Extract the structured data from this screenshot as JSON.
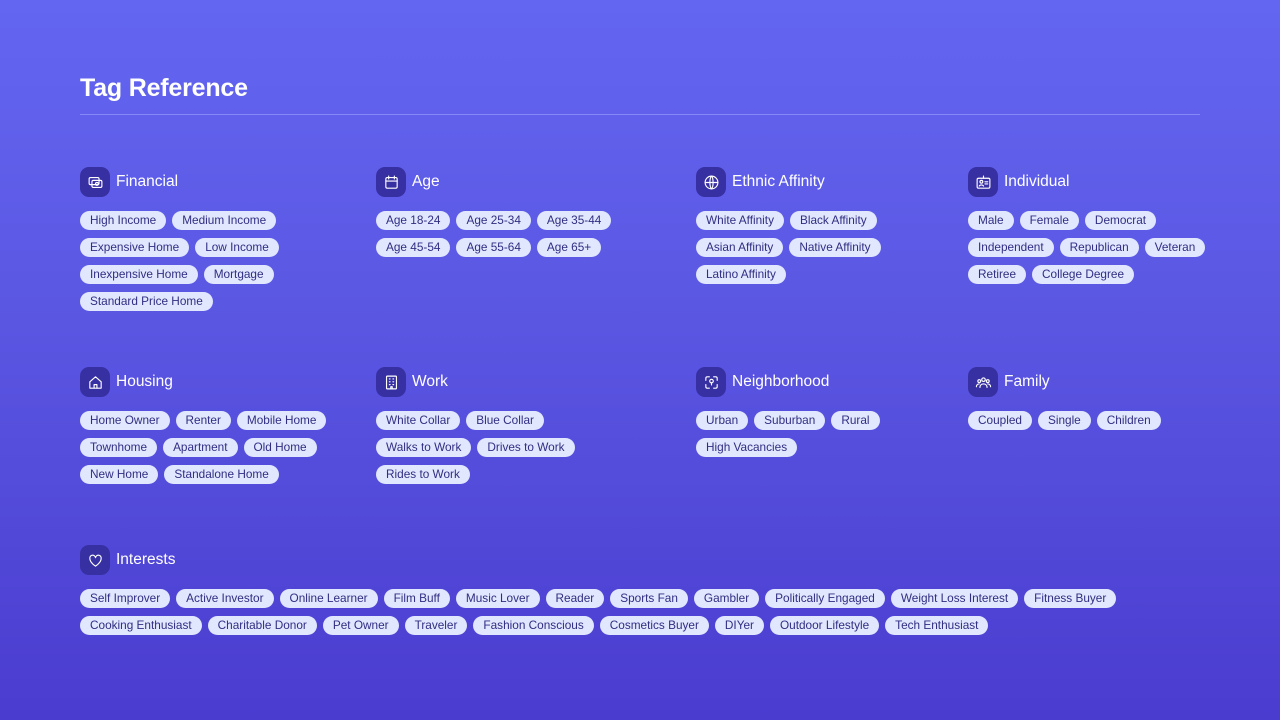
{
  "page": {
    "title": "Tag Reference"
  },
  "colors": {
    "tag_bg": "#e0e7ff",
    "tag_text": "#312e81",
    "icon_bg": "#3730a3",
    "background": "#5a56e2"
  },
  "sections": [
    {
      "title": "Financial",
      "icon": "money-icon",
      "tags": [
        "High Income",
        "Medium Income",
        "Expensive Home",
        "Low Income",
        "Inexpensive Home",
        "Mortgage",
        "Standard Price Home"
      ]
    },
    {
      "title": "Age",
      "icon": "calendar-icon",
      "tags": [
        "Age 18-24",
        "Age 25-34",
        "Age 35-44",
        "Age 45-54",
        "Age 55-64",
        "Age 65+"
      ]
    },
    {
      "title": "Ethnic Affinity",
      "icon": "globe-icon",
      "tags": [
        "White Affinity",
        "Black Affinity",
        "Asian Affinity",
        "Native Affinity",
        "Latino Affinity"
      ]
    },
    {
      "title": "Individual",
      "icon": "id-card-icon",
      "tags": [
        "Male",
        "Female",
        "Democrat",
        "Independent",
        "Republican",
        "Veteran",
        "Retiree",
        "College Degree"
      ]
    },
    {
      "title": "Housing",
      "icon": "home-icon",
      "tags": [
        "Home Owner",
        "Renter",
        "Mobile Home",
        "Townhome",
        "Apartment",
        "Old Home",
        "New Home",
        "Standalone Home"
      ]
    },
    {
      "title": "Work",
      "icon": "building-icon",
      "tags": [
        "White Collar",
        "Blue Collar",
        "Walks to Work",
        "Drives to Work",
        "Rides to Work"
      ]
    },
    {
      "title": "Neighborhood",
      "icon": "location-focus-icon",
      "tags": [
        "Urban",
        "Suburban",
        "Rural",
        "High Vacancies"
      ]
    },
    {
      "title": "Family",
      "icon": "users-icon",
      "tags": [
        "Coupled",
        "Single",
        "Children"
      ]
    },
    {
      "title": "Interests",
      "icon": "heart-icon",
      "tags": [
        "Self Improver",
        "Active Investor",
        "Online Learner",
        "Film Buff",
        "Music Lover",
        "Reader",
        "Sports Fan",
        "Gambler",
        "Politically Engaged",
        "Weight Loss Interest",
        "Fitness Buyer",
        "Cooking Enthusiast",
        "Charitable Donor",
        "Pet Owner",
        "Traveler",
        "Fashion Conscious",
        "Cosmetics Buyer",
        "DIYer",
        "Outdoor Lifestyle",
        "Tech Enthusiast"
      ]
    }
  ]
}
